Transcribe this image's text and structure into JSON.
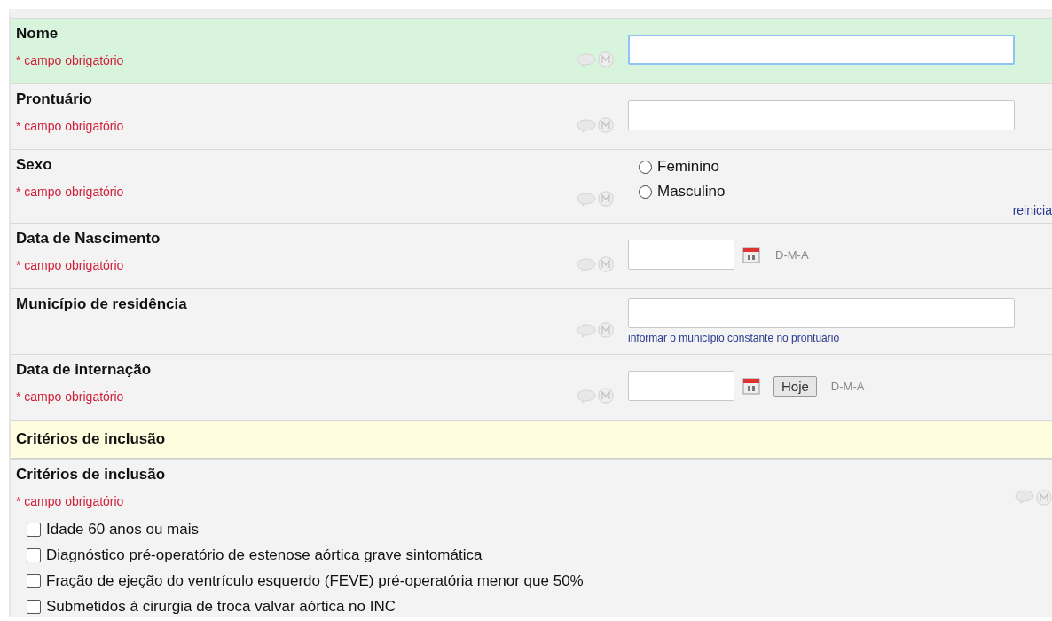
{
  "fields": [
    {
      "kind": "text",
      "label": "Nome",
      "required_note": "* campo obrigatório",
      "highlighted": true,
      "focused": true
    },
    {
      "kind": "text",
      "label": "Prontuário",
      "required_note": "* campo obrigatório",
      "highlighted": false,
      "focused": false
    },
    {
      "kind": "radio",
      "label": "Sexo",
      "required_note": "* campo obrigatório",
      "highlighted": false,
      "options": [
        {
          "label": "Feminino",
          "selected": false
        },
        {
          "label": "Masculino",
          "selected": false
        }
      ],
      "reset_link": "reinicia"
    },
    {
      "kind": "date",
      "label": "Data de Nascimento",
      "required_note": "* campo obrigatório",
      "highlighted": false,
      "format": "D-M-A"
    },
    {
      "kind": "text",
      "label": "Município de residência",
      "highlighted": false,
      "focused": false,
      "note": "informar o município constante no prontuário"
    },
    {
      "kind": "date",
      "label": "Data de internação",
      "required_note": "* campo obrigatório",
      "highlighted": false,
      "today_button": "Hoje",
      "format": "D-M-A"
    },
    {
      "kind": "section",
      "label": "Critérios de inclusão"
    },
    {
      "kind": "checkboxes",
      "label": "Critérios de inclusão",
      "required_note": "* campo obrigatório",
      "highlighted": false,
      "options": [
        {
          "label": "Idade 60 anos ou mais",
          "checked": false
        },
        {
          "label": "Diagnóstico pré-operatório de estenose aórtica grave sintomática",
          "checked": false
        },
        {
          "label": "Fração de ejeção do ventrículo esquerdo (FEVE) pré-operatória menor que 50%",
          "checked": false
        },
        {
          "label": "Submetidos à cirurgia de troca valvar aórtica no INC",
          "checked": false
        }
      ]
    }
  ]
}
